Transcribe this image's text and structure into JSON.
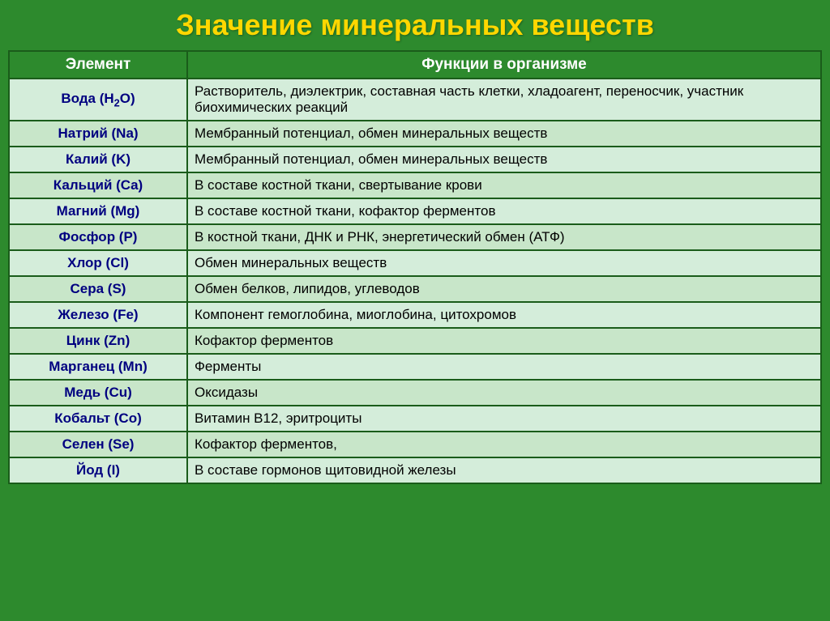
{
  "title": "Значение минеральных веществ",
  "table": {
    "header": {
      "col1": "Элемент",
      "col2": "Функции в организме"
    },
    "rows": [
      {
        "element": "Вода (Н₂О)",
        "function": "Растворитель, диэлектрик, составная часть клетки, хладоагент, переносчик, участник биохимических реакций",
        "water": true
      },
      {
        "element": "Натрий (Na)",
        "function": "Мембранный потенциал, обмен минеральных веществ"
      },
      {
        "element": "Калий (K)",
        "function": "Мембранный потенциал, обмен минеральных веществ"
      },
      {
        "element": "Кальций (Ca)",
        "function": "В составе костной ткани, свертывание крови"
      },
      {
        "element": "Магний (Mg)",
        "function": "В составе костной ткани, кофактор ферментов"
      },
      {
        "element": "Фосфор (P)",
        "function": "В костной ткани,  ДНК и РНК, энергетический обмен  (АТФ)"
      },
      {
        "element": "Хлор (Cl)",
        "function": "Обмен минеральных веществ"
      },
      {
        "element": "Сера (S)",
        "function": "Обмен белков, липидов, углеводов"
      },
      {
        "element": "Железо (Fe)",
        "function": "Компонент гемоглобина, миоглобина, цитохромов"
      },
      {
        "element": "Цинк (Zn)",
        "function": "Кофактор ферментов"
      },
      {
        "element": "Марганец (Mn)",
        "function": "Ферменты"
      },
      {
        "element": "Медь (Cu)",
        "function": "Оксидазы"
      },
      {
        "element": "Кобальт (Co)",
        "function": "Витамин В12, эритроциты"
      },
      {
        "element": "Селен (Se)",
        "function": "Кофактор ферментов,"
      },
      {
        "element": "Йод (I)",
        "function": "В составе гормонов щитовидной железы"
      }
    ]
  }
}
